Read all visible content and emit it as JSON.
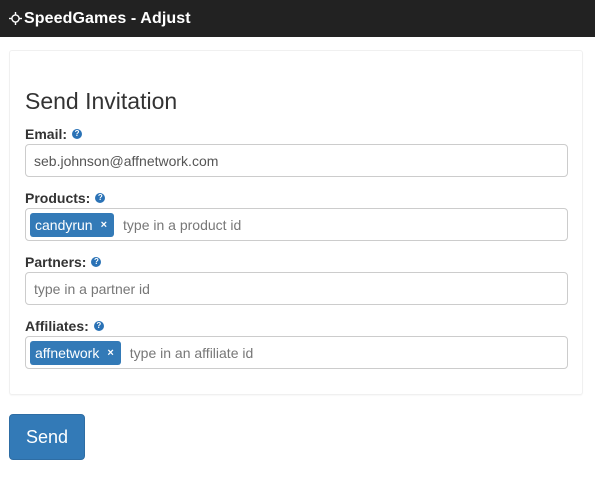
{
  "header": {
    "brand_icon": "crosshair-move-icon",
    "title": "SpeedGames - Adjust"
  },
  "form": {
    "title": "Send Invitation",
    "help_icon": "question-circle-icon",
    "help_glyph": "?",
    "email": {
      "label": "Email:",
      "value": "seb.johnson@affnetwork.com"
    },
    "products": {
      "label": "Products:",
      "tags": [
        "candyrun"
      ],
      "placeholder": "type in a product id"
    },
    "partners": {
      "label": "Partners:",
      "placeholder": "type in a partner id"
    },
    "affiliates": {
      "label": "Affiliates:",
      "tags": [
        "affnetwork"
      ],
      "placeholder": "type in an affiliate id"
    },
    "tag_remove_glyph": "×",
    "send_label": "Send"
  },
  "colors": {
    "topbar": "#222222",
    "primary": "#337ab7",
    "help_icon": "#2a72b6"
  }
}
